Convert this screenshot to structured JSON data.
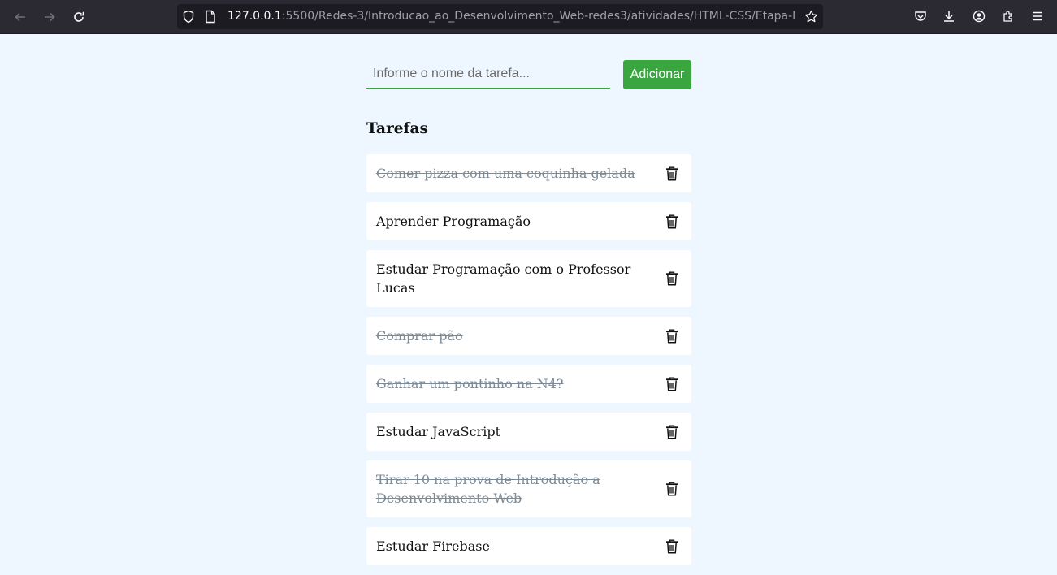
{
  "browser": {
    "url_host": "127.0.0.1",
    "url_path": ":5500/Redes-3/Introducao_ao_Desenvolvimento_Web-redes3/atividades/HTML-CSS/Etapa-N"
  },
  "form": {
    "placeholder": "Informe o nome da tarefa...",
    "value": "",
    "add_label": "Adicionar"
  },
  "heading": "Tarefas",
  "tasks": [
    {
      "label": "Comer pizza com uma coquinha gelada",
      "done": true
    },
    {
      "label": "Aprender Programação",
      "done": false
    },
    {
      "label": "Estudar Programação com o Professor Lucas",
      "done": false
    },
    {
      "label": "Comprar pão",
      "done": true
    },
    {
      "label": "Ganhar um pontinho na N4?",
      "done": true
    },
    {
      "label": "Estudar JavaScript",
      "done": false
    },
    {
      "label": "Tirar 10 na prova de Introdução a Desenvolvimento Web",
      "done": true
    },
    {
      "label": "Estudar Firebase",
      "done": false
    }
  ],
  "colors": {
    "page_bg": "#eef7ff",
    "accent_green": "#3aa63f",
    "done_text": "#7b8a96"
  }
}
